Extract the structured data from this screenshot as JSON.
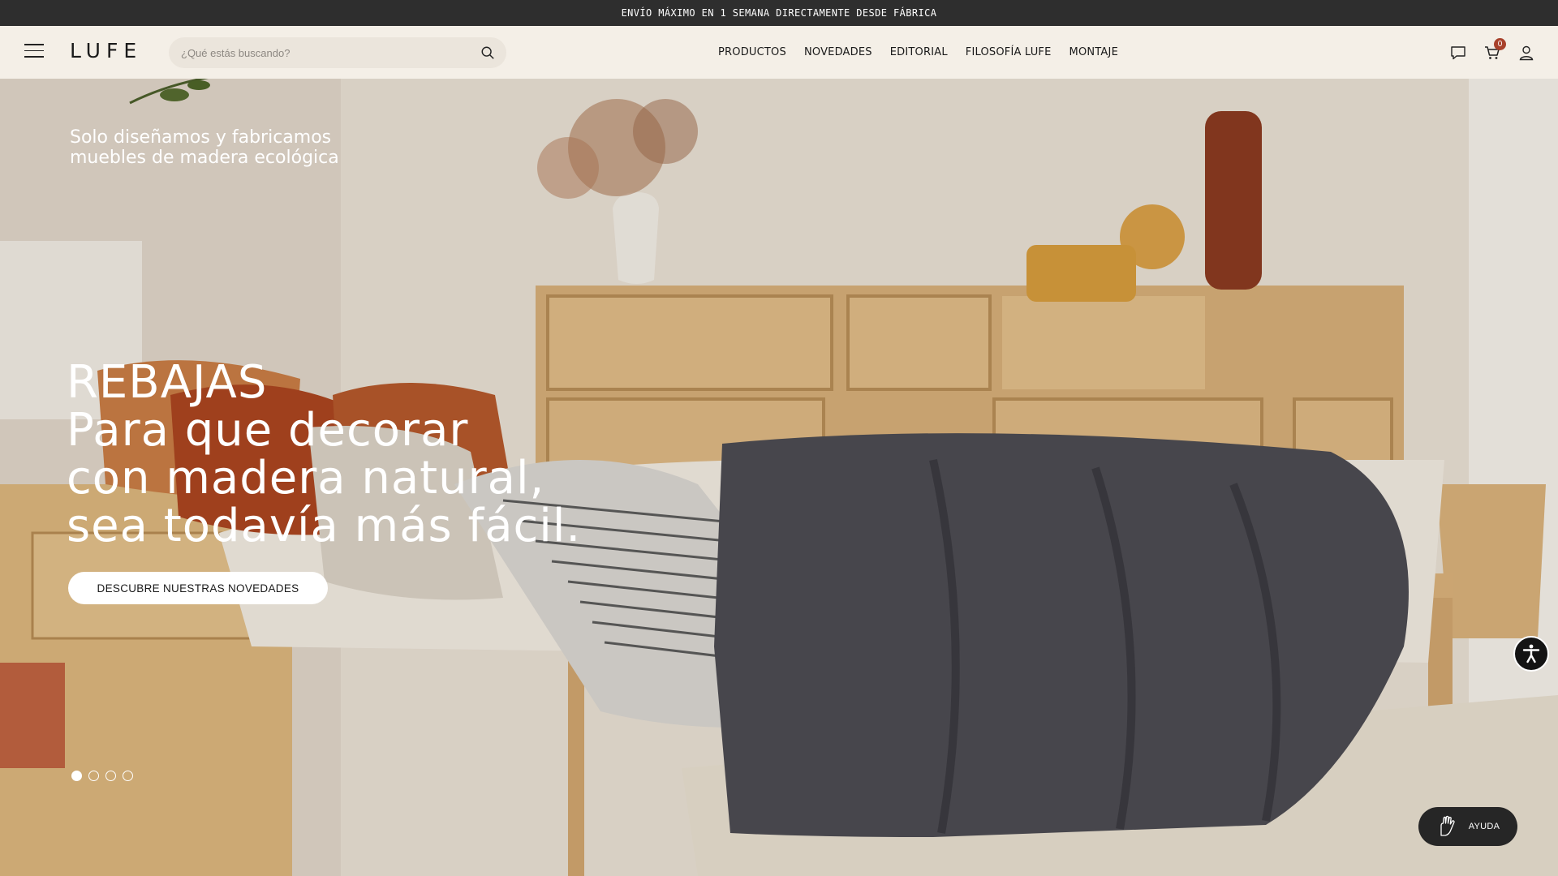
{
  "topbar": {
    "text": "ENVÍO MÁXIMO EN 1 SEMANA DIRECTAMENTE DESDE FÁBRICA"
  },
  "header": {
    "logo": "LUFE",
    "search_placeholder": "¿Qué estás buscando?",
    "nav": [
      "PRODUCTOS",
      "NOVEDADES",
      "EDITORIAL",
      "FILOSOFÍA LUFE",
      "MONTAJE"
    ],
    "cart_count": "0",
    "icons": [
      "menu-icon",
      "search-icon",
      "chat-icon",
      "cart-icon",
      "user-icon"
    ]
  },
  "hero": {
    "tagline": "Solo diseñamos y fabricamos muebles de madera ecológica",
    "headline": [
      "REBAJAS",
      "Para que decorar",
      "con madera natural,",
      "sea todavía más fácil."
    ],
    "cta": "DESCUBRE NUESTRAS NOVEDADES",
    "slides": 4,
    "active_slide": 1
  },
  "widgets": {
    "help_label": "AYUDA",
    "accessibility_icon": "accessibility-icon"
  },
  "colors": {
    "topbar": "#2e2e2e",
    "header": "#f4efe7",
    "badge": "#a8412b",
    "cta_bg": "#ffffff"
  }
}
